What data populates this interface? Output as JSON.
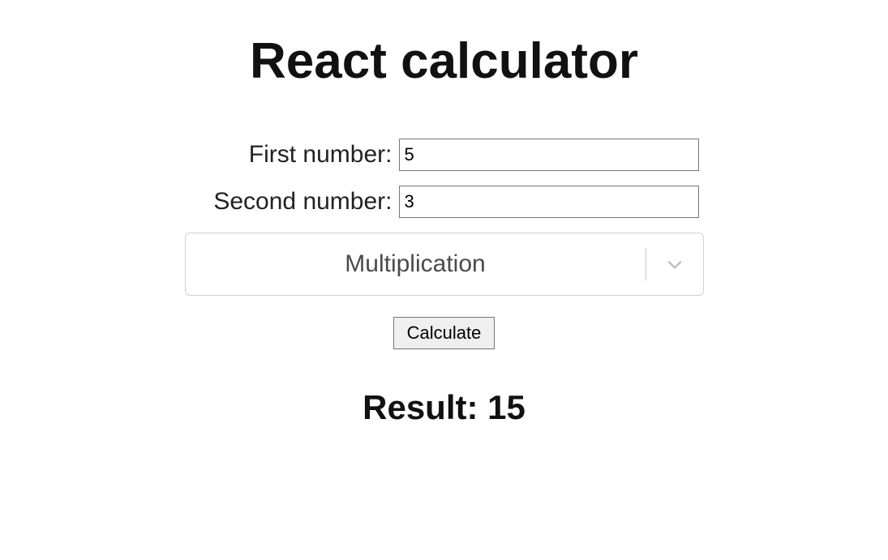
{
  "title": "React calculator",
  "fields": {
    "first_label": "First number:",
    "first_value": "5",
    "second_label": "Second number:",
    "second_value": "3"
  },
  "operation": {
    "selected": "Multiplication"
  },
  "button": {
    "calculate": "Calculate"
  },
  "result": {
    "label": "Result: ",
    "value": "15"
  }
}
